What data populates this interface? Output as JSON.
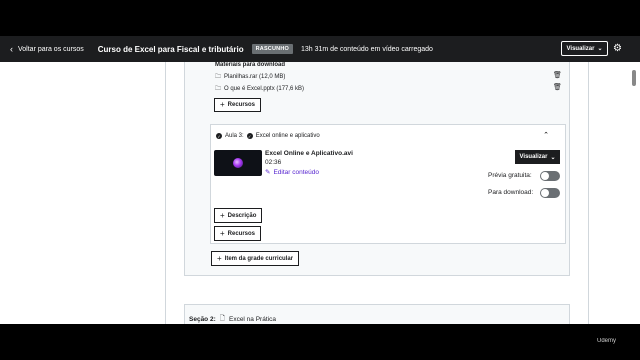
{
  "topbar": {
    "back_label": "Voltar para os cursos",
    "course_title": "Curso de Excel para Fiscal e tributário",
    "status_badge": "RASCUNHO",
    "uploaded_text": "13h 31m de conteúdo em vídeo carregado",
    "preview_label": "Visualizar",
    "settings_icon": "gear-icon"
  },
  "section1": {
    "downloads_label": "Materiais para download",
    "files": [
      {
        "name": "Planilhas.rar (12,0 MB)"
      },
      {
        "name": "O que é Excel.pptx (177,6 kB)"
      }
    ],
    "resources_button": "Recursos",
    "lecture": {
      "number_label": "Aula 3:",
      "title": "Excel online e aplicativo",
      "video_filename": "Excel Online e Aplicativo.avi",
      "duration": "02:36",
      "edit_label": "Editar conteúdo",
      "preview_button": "Visualizar",
      "free_preview_label": "Prévia gratuita:",
      "free_preview_on": false,
      "downloadable_label": "Para download:",
      "downloadable_on": false,
      "description_button": "Descrição",
      "resources_button": "Recursos"
    },
    "curriculum_item_button": "Item da grade curricular"
  },
  "section2": {
    "label": "Seção 2:",
    "title": "Excel na Prática"
  },
  "watermark": "Udemy"
}
